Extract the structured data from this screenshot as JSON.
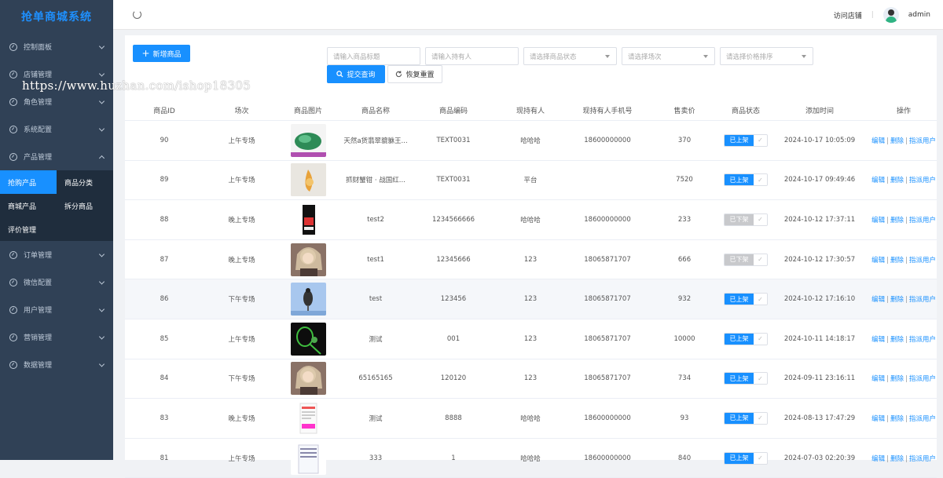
{
  "app": {
    "title": "抢单商城系统"
  },
  "watermark": "https://www.huzhan.com/ishop18305",
  "colors": {
    "accent": "#1890ff",
    "sidebar": "#304156",
    "status_on": "#1890ff",
    "status_off": "#c8c9cc"
  },
  "sidebar": {
    "items_top": [
      {
        "label": "控制面板",
        "expanded": false
      },
      {
        "label": "店铺管理",
        "expanded": false
      },
      {
        "label": "角色管理",
        "expanded": false
      },
      {
        "label": "系统配置",
        "expanded": false
      },
      {
        "label": "产品管理",
        "expanded": true
      }
    ],
    "submenu": [
      "抢购产品",
      "商品分类",
      "商城产品",
      "拆分商品",
      "评价管理"
    ],
    "items_bottom": [
      {
        "label": "订单管理"
      },
      {
        "label": "微信配置"
      },
      {
        "label": "用户管理"
      },
      {
        "label": "营销管理"
      },
      {
        "label": "数据管理"
      }
    ]
  },
  "header": {
    "visit_store": "访问店铺",
    "separator": "|",
    "user": "admin"
  },
  "toolbar": {
    "add_label": "新增商品"
  },
  "filters": {
    "title_placeholder": "请输入商品标题",
    "owner_placeholder": "请输入持有人",
    "status_placeholder": "请选择商品状态",
    "session_placeholder": "请选择场次",
    "price_sort_placeholder": "请选择价格排序",
    "submit_label": "提交查询",
    "reset_label": "恢复重置"
  },
  "table": {
    "headers": [
      "商品ID",
      "场次",
      "商品图片",
      "商品名称",
      "商品编码",
      "现持有人",
      "现持有人手机号",
      "售卖价",
      "商品状态",
      "添加时间",
      "操作"
    ],
    "ops": {
      "edit": "编辑",
      "delete": "删除",
      "assign": "指派用户",
      "sep": "|"
    },
    "rows": [
      {
        "id": "90",
        "session": "上午专场",
        "thumb": "jade",
        "name": "天然a货翡翠貔貅王...",
        "code": "TEXT0031",
        "owner": "哈哈哈",
        "phone": "18600000000",
        "price": "370",
        "status": "已上架",
        "on": true,
        "time": "2024-10-17 10:05:09"
      },
      {
        "id": "89",
        "session": "上午专场",
        "thumb": "crab",
        "name": "抓财蟹钳 · 战国红...",
        "code": "TEXT0031",
        "owner": "平台",
        "phone": "",
        "price": "7520",
        "status": "已上架",
        "on": true,
        "time": "2024-10-17 09:49:46"
      },
      {
        "id": "88",
        "session": "晚上专场",
        "thumb": "phone",
        "name": "test2",
        "code": "1234566666",
        "owner": "哈哈哈",
        "phone": "18600000000",
        "price": "233",
        "status": "已下架",
        "on": false,
        "time": "2024-10-12 17:37:11"
      },
      {
        "id": "87",
        "session": "晚上专场",
        "thumb": "portrait",
        "name": "test1",
        "code": "12345666",
        "owner": "123",
        "phone": "18065871707",
        "price": "666",
        "status": "已下架",
        "on": false,
        "time": "2024-10-12 17:30:57"
      },
      {
        "id": "86",
        "session": "下午专场",
        "thumb": "bird",
        "name": "test",
        "code": "123456",
        "owner": "123",
        "phone": "18065871707",
        "price": "932",
        "status": "已上架",
        "on": true,
        "time": "2024-10-12 17:16:10"
      },
      {
        "id": "85",
        "session": "上午专场",
        "thumb": "racket",
        "name": "测试",
        "code": "001",
        "owner": "123",
        "phone": "18065871707",
        "price": "10000",
        "status": "已上架",
        "on": true,
        "time": "2024-10-11 14:18:17"
      },
      {
        "id": "84",
        "session": "下午专场",
        "thumb": "portrait",
        "name": "65165165",
        "code": "120120",
        "owner": "123",
        "phone": "18065871707",
        "price": "734",
        "status": "已上架",
        "on": true,
        "time": "2024-09-11 23:16:11"
      },
      {
        "id": "83",
        "session": "晚上专场",
        "thumb": "doc",
        "name": "测试",
        "code": "8888",
        "owner": "哈哈哈",
        "phone": "18600000000",
        "price": "93",
        "status": "已上架",
        "on": true,
        "time": "2024-08-13 17:47:29"
      },
      {
        "id": "81",
        "session": "上午专场",
        "thumb": "doc2",
        "name": "333",
        "code": "1",
        "owner": "哈哈哈",
        "phone": "18600000000",
        "price": "840",
        "status": "已上架",
        "on": true,
        "time": "2024-07-03 02:20:39"
      }
    ]
  }
}
